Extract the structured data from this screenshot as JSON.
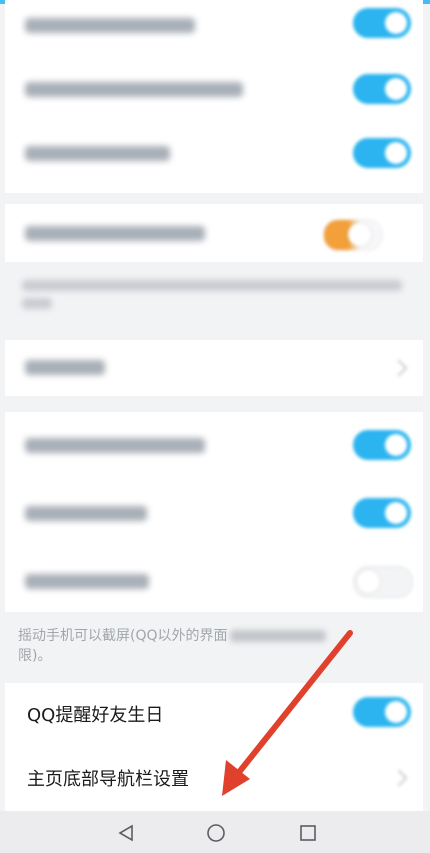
{
  "settings_rows": [
    {
      "label": "",
      "toggle": "on"
    },
    {
      "label": "",
      "toggle": "on"
    },
    {
      "label": "",
      "toggle": "on"
    },
    {
      "label": "",
      "toggle": "turning-off"
    },
    {
      "label": "",
      "type": "chevron"
    },
    {
      "label": "",
      "toggle": "on"
    },
    {
      "label": "",
      "toggle": "on"
    },
    {
      "label": "",
      "toggle": "off"
    }
  ],
  "shake_screenshot_note": "摇动手机可以截屏(QQ以外的界面",
  "shake_screenshot_note_tail": "限)。",
  "birthday_reminder": {
    "label": "QQ提醒好友生日",
    "toggle": "on"
  },
  "bottom_nav_setting": {
    "label": "主页底部导航栏设置"
  },
  "nav": {
    "back": "back-icon",
    "home": "home-icon",
    "recents": "recents-icon"
  },
  "colors": {
    "toggle_on": "#2bb4ef",
    "toggle_transition": "#f3a03a",
    "arrow": "#e0412c",
    "background": "#f2f3f5"
  }
}
